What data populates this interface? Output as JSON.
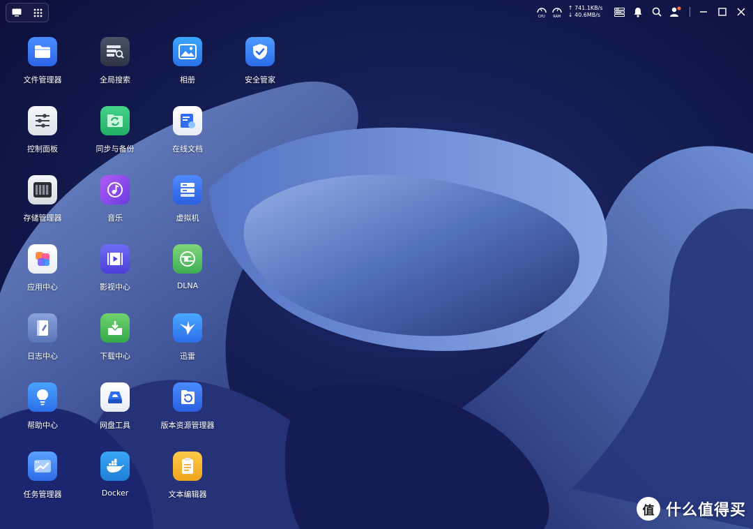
{
  "status": {
    "cpu_label": "CPU",
    "ram_label": "RAM",
    "upload": "741.1KB/s",
    "download": "40.6MB/s",
    "upload_arrow": "↑",
    "download_arrow": "↓"
  },
  "apps": [
    {
      "label": "文件管理器",
      "icon": "folder-icon"
    },
    {
      "label": "全局搜索",
      "icon": "global-search-icon"
    },
    {
      "label": "相册",
      "icon": "photo-album-icon"
    },
    {
      "label": "安全管家",
      "icon": "security-shield-icon"
    },
    {
      "label": "控制面板",
      "icon": "control-panel-sliders-icon"
    },
    {
      "label": "同步与备份",
      "icon": "sync-backup-icon"
    },
    {
      "label": "在线文档",
      "icon": "online-docs-icon"
    },
    {
      "label": "存储管理器",
      "icon": "storage-manager-icon"
    },
    {
      "label": "音乐",
      "icon": "music-icon"
    },
    {
      "label": "虚拟机",
      "icon": "virtual-machine-icon"
    },
    {
      "label": "应用中心",
      "icon": "app-center-icon"
    },
    {
      "label": "影视中心",
      "icon": "video-center-icon"
    },
    {
      "label": "DLNA",
      "icon": "dlna-icon"
    },
    {
      "label": "日志中心",
      "icon": "log-center-icon"
    },
    {
      "label": "下载中心",
      "icon": "download-center-icon"
    },
    {
      "label": "迅雷",
      "icon": "xunlei-bird-icon"
    },
    {
      "label": "帮助中心",
      "icon": "help-bulb-icon"
    },
    {
      "label": "网盘工具",
      "icon": "cloud-drive-tool-icon"
    },
    {
      "label": "版本资源管理器",
      "icon": "version-explorer-icon"
    },
    {
      "label": "任务管理器",
      "icon": "task-manager-icon"
    },
    {
      "label": "Docker",
      "icon": "docker-whale-icon"
    },
    {
      "label": "文本编辑器",
      "icon": "text-editor-icon"
    }
  ],
  "watermark": {
    "text": "什么值得买",
    "glyph": "值"
  },
  "colors": {
    "desktop_bg": "#0b0e3a",
    "accent": "#3f7bf0"
  }
}
